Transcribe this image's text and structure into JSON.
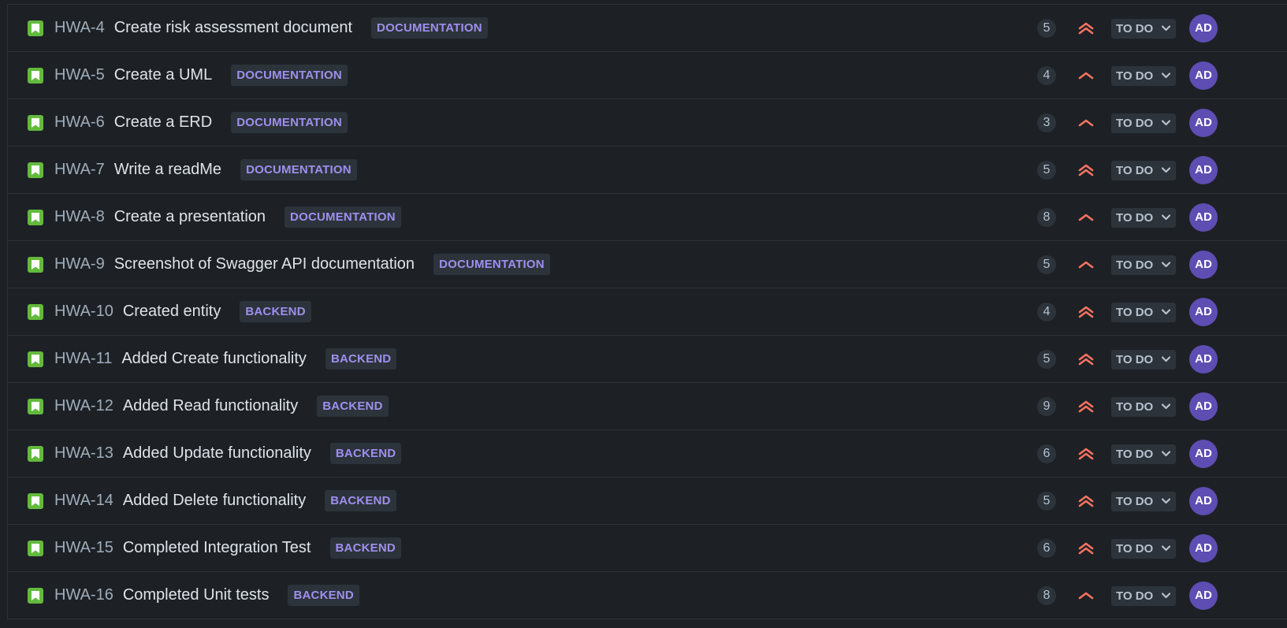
{
  "colors": {
    "background": "#1d2125",
    "issue_type_story": "#63ba3c",
    "label_text": "#9f8fef",
    "priority_orange": "#f87462",
    "avatar_bg": "#5e4db2"
  },
  "icons": {
    "issue_type": "story-bookmark-icon",
    "priority_high": "double-chevron-up-icon",
    "priority_medium": "chevron-up-icon",
    "status_dropdown": "chevron-down-icon"
  },
  "issues": [
    {
      "key": "HWA-4",
      "summary": "Create risk assessment document",
      "label": "DOCUMENTATION",
      "points": "5",
      "priority": "high",
      "status": "TO DO",
      "assignee": "AD"
    },
    {
      "key": "HWA-5",
      "summary": "Create a UML",
      "label": "DOCUMENTATION",
      "points": "4",
      "priority": "medium",
      "status": "TO DO",
      "assignee": "AD"
    },
    {
      "key": "HWA-6",
      "summary": "Create a ERD",
      "label": "DOCUMENTATION",
      "points": "3",
      "priority": "medium",
      "status": "TO DO",
      "assignee": "AD"
    },
    {
      "key": "HWA-7",
      "summary": "Write a readMe",
      "label": "DOCUMENTATION",
      "points": "5",
      "priority": "high",
      "status": "TO DO",
      "assignee": "AD"
    },
    {
      "key": "HWA-8",
      "summary": "Create a presentation",
      "label": "DOCUMENTATION",
      "points": "8",
      "priority": "medium",
      "status": "TO DO",
      "assignee": "AD"
    },
    {
      "key": "HWA-9",
      "summary": "Screenshot of Swagger API documentation",
      "label": "DOCUMENTATION",
      "points": "5",
      "priority": "medium",
      "status": "TO DO",
      "assignee": "AD"
    },
    {
      "key": "HWA-10",
      "summary": "Created entity",
      "label": "BACKEND",
      "points": "4",
      "priority": "high",
      "status": "TO DO",
      "assignee": "AD"
    },
    {
      "key": "HWA-11",
      "summary": "Added Create functionality",
      "label": "BACKEND",
      "points": "5",
      "priority": "high",
      "status": "TO DO",
      "assignee": "AD"
    },
    {
      "key": "HWA-12",
      "summary": "Added Read functionality",
      "label": "BACKEND",
      "points": "9",
      "priority": "high",
      "status": "TO DO",
      "assignee": "AD"
    },
    {
      "key": "HWA-13",
      "summary": "Added Update functionality",
      "label": "BACKEND",
      "points": "6",
      "priority": "high",
      "status": "TO DO",
      "assignee": "AD"
    },
    {
      "key": "HWA-14",
      "summary": "Added Delete functionality",
      "label": "BACKEND",
      "points": "5",
      "priority": "high",
      "status": "TO DO",
      "assignee": "AD"
    },
    {
      "key": "HWA-15",
      "summary": "Completed Integration Test",
      "label": "BACKEND",
      "points": "6",
      "priority": "high",
      "status": "TO DO",
      "assignee": "AD"
    },
    {
      "key": "HWA-16",
      "summary": "Completed Unit tests",
      "label": "BACKEND",
      "points": "8",
      "priority": "medium",
      "status": "TO DO",
      "assignee": "AD"
    }
  ]
}
